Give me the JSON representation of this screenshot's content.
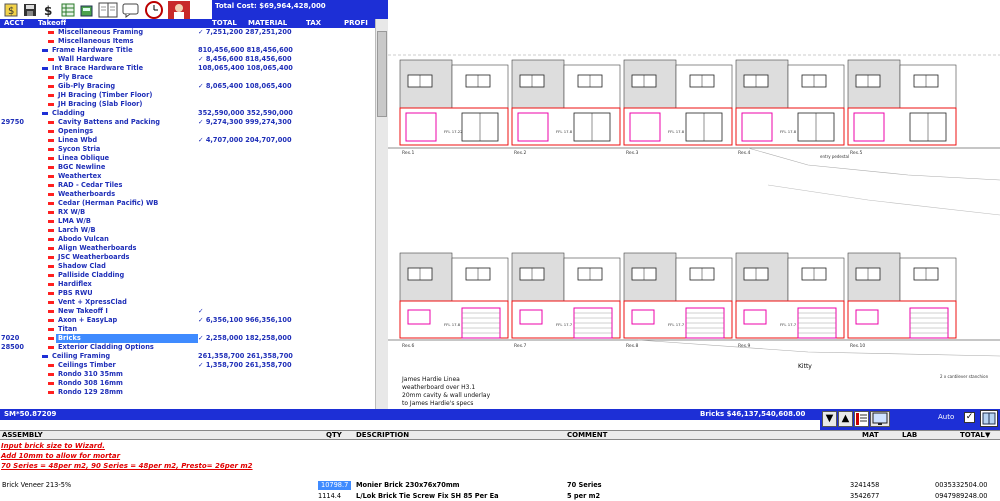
{
  "toolbar": {
    "icons": [
      "dollar-icon",
      "save-icon",
      "money-icon",
      "spreadsheet-icon",
      "calculator-icon",
      "open-book-icon",
      "clock-icon",
      "user-avatar-icon"
    ],
    "total_cost": "Total Cost: $69,964,428,000"
  },
  "takeoff_header": {
    "acct": "ACCT",
    "takeoff": "Takeoff",
    "total": "TOTAL",
    "material": "MATERIAL",
    "tax": "TAX",
    "profit": "PROFI"
  },
  "tree": {
    "rows": [
      {
        "acct": "",
        "level": 3,
        "color": "#ff2020",
        "label": "Miscellaneous Framing",
        "total": "✓ 7,251,200 287,251,200"
      },
      {
        "acct": "",
        "level": 3,
        "color": "#ff2020",
        "label": "Miscellaneous Items",
        "total": ""
      },
      {
        "acct": "",
        "level": 2,
        "color": "#1d2fd6",
        "label": "Frame Hardware Title",
        "total": "810,456,600 818,456,600"
      },
      {
        "acct": "",
        "level": 3,
        "color": "#ff2020",
        "label": "Wall Hardware",
        "total": "✓ 8,456,600 818,456,600"
      },
      {
        "acct": "",
        "level": 2,
        "color": "#1d2fd6",
        "label": "Int Brace Hardware Title",
        "total": "108,065,400 108,065,400"
      },
      {
        "acct": "",
        "level": 3,
        "color": "#ff2020",
        "label": "Ply Brace",
        "total": ""
      },
      {
        "acct": "",
        "level": 3,
        "color": "#ff2020",
        "label": "Gib-Ply Bracing",
        "total": "✓ 8,065,400 108,065,400"
      },
      {
        "acct": "",
        "level": 3,
        "color": "#ff2020",
        "label": "JH Bracing (Timber Floor)",
        "total": ""
      },
      {
        "acct": "",
        "level": 3,
        "color": "#ff2020",
        "label": "JH Bracing (Slab Floor)",
        "total": ""
      },
      {
        "acct": "",
        "level": 2,
        "color": "#1d2fd6",
        "label": "Cladding",
        "total": "352,590,000 352,590,000"
      },
      {
        "acct": "29750",
        "level": 3,
        "color": "#ff2020",
        "label": "Cavity Battens and Packing",
        "total": "✓ 9,274,300 999,274,300"
      },
      {
        "acct": "",
        "level": 3,
        "color": "#ff2020",
        "label": "Openings",
        "total": ""
      },
      {
        "acct": "",
        "level": 3,
        "color": "#ff2020",
        "label": "Linea Wbd",
        "total": "✓ 4,707,000 204,707,000"
      },
      {
        "acct": "",
        "level": 3,
        "color": "#ff2020",
        "label": "Sycon Stria",
        "total": ""
      },
      {
        "acct": "",
        "level": 3,
        "color": "#ff2020",
        "label": "Linea Oblique",
        "total": ""
      },
      {
        "acct": "",
        "level": 3,
        "color": "#ff2020",
        "label": "BGC Newline",
        "total": ""
      },
      {
        "acct": "",
        "level": 3,
        "color": "#ff2020",
        "label": "Weathertex",
        "total": ""
      },
      {
        "acct": "",
        "level": 3,
        "color": "#ff2020",
        "label": "RAD - Cedar Tiles",
        "total": ""
      },
      {
        "acct": "",
        "level": 3,
        "color": "#ff2020",
        "label": "Weatherboards",
        "total": ""
      },
      {
        "acct": "",
        "level": 3,
        "color": "#ff2020",
        "label": "Cedar (Herman Pacific) WB",
        "total": ""
      },
      {
        "acct": "",
        "level": 3,
        "color": "#ff2020",
        "label": "RX W/B",
        "total": ""
      },
      {
        "acct": "",
        "level": 3,
        "color": "#ff2020",
        "label": "LMA W/B",
        "total": ""
      },
      {
        "acct": "",
        "level": 3,
        "color": "#ff2020",
        "label": "Larch W/B",
        "total": ""
      },
      {
        "acct": "",
        "level": 3,
        "color": "#ff2020",
        "label": "Abodo Vulcan",
        "total": ""
      },
      {
        "acct": "",
        "level": 3,
        "color": "#ff2020",
        "label": "Align Weatherboards",
        "total": ""
      },
      {
        "acct": "",
        "level": 3,
        "color": "#ff2020",
        "label": "JSC Weatherboards",
        "total": ""
      },
      {
        "acct": "",
        "level": 3,
        "color": "#ff2020",
        "label": "Shadow Clad",
        "total": ""
      },
      {
        "acct": "",
        "level": 3,
        "color": "#ff2020",
        "label": "Palliside Cladding",
        "total": ""
      },
      {
        "acct": "",
        "level": 3,
        "color": "#ff2020",
        "label": "Hardiflex",
        "total": ""
      },
      {
        "acct": "",
        "level": 3,
        "color": "#ff2020",
        "label": "PBS RWU",
        "total": ""
      },
      {
        "acct": "",
        "level": 3,
        "color": "#ff2020",
        "label": "Vent + XpressClad",
        "total": ""
      },
      {
        "acct": "",
        "level": 3,
        "color": "#ff2020",
        "label": "New Takeoff I",
        "total": "✓"
      },
      {
        "acct": "",
        "level": 3,
        "color": "#ff2020",
        "label": "Axon + EasyLap",
        "total": "✓ 6,356,100 966,356,100"
      },
      {
        "acct": "",
        "level": 3,
        "color": "#ff2020",
        "label": "Titan",
        "total": ""
      },
      {
        "acct": "7020",
        "level": 3,
        "color": "#ff2020",
        "label": "Bricks",
        "total": "✓ 2,258,000 182,258,000",
        "selected": true
      },
      {
        "acct": "28500",
        "level": 3,
        "color": "#ff2020",
        "label": "Exterior Cladding Options",
        "total": ""
      },
      {
        "acct": "",
        "level": 2,
        "color": "#1d2fd6",
        "label": "Ceiling Framing",
        "total": "261,358,700 261,358,700"
      },
      {
        "acct": "",
        "level": 3,
        "color": "#ff2020",
        "label": "Ceilings Timber",
        "total": "✓ 1,358,700 261,358,700"
      },
      {
        "acct": "",
        "level": 3,
        "color": "#ff2020",
        "label": "Rondo 310 35mm",
        "total": ""
      },
      {
        "acct": "",
        "level": 3,
        "color": "#ff2020",
        "label": "Rondo 308 16mm",
        "total": ""
      },
      {
        "acct": "",
        "level": 3,
        "color": "#ff2020",
        "label": "Rondo 129 28mm",
        "total": ""
      }
    ]
  },
  "drawing": {
    "upper_labels": [
      "Res.1",
      "Res.2",
      "Res.3",
      "Res.4",
      "Res.5"
    ],
    "lower_labels": [
      "Res.6",
      "Res.7",
      "Res.8",
      "Res.9",
      "Res.10"
    ],
    "upper_ffl": [
      "FFL 17.22",
      "FFL 17.8",
      "FFL 17.8",
      "FFL 17.8"
    ],
    "lower_ffl": [
      "FFL 17.8",
      "FFL 17.7",
      "FFL 17.7",
      "FFL 17.7"
    ],
    "upper_note": "entry pedestal",
    "side_note": "2 x cantilever stanchion",
    "note_title": "Kitty",
    "note_lines": [
      "James Hardie Linea",
      "weatherboard over H3.1",
      "20mm cavity & wall underlay",
      "to James Hardie's specs"
    ]
  },
  "status_bar": {
    "left": "SM*50.87209",
    "right": "Bricks $46,137,540,608.00",
    "auto_label": "Auto",
    "icons": [
      "down-arrow-icon",
      "up-arrow-icon",
      "grid-view-icon",
      "monitor-icon",
      "book-icon"
    ]
  },
  "assembly_header": {
    "assembly": "ASSEMBLY",
    "qty": "QTY",
    "description": "DESCRIPTION",
    "comment": "COMMENT",
    "mat": "MAT",
    "lab": "LAB",
    "total": "TOTAL"
  },
  "notes": [
    "Input brick size to Wizard.",
    "Add 10mm to allow for mortar",
    "70 Series = 48per m2, 90 Series = 48per m2, Presto= 26per m2"
  ],
  "assembly_rows": [
    {
      "assembly": "Brick Veneer  213-5%",
      "qty": "10798.7",
      "description": "Monier Brick 230x76x70mm",
      "comment": "70 Series",
      "mat": "3241458",
      "total": "0035332504.00",
      "selected": true
    },
    {
      "assembly": "",
      "qty": "1114.4",
      "description": "L/Lok Brick Tie Screw Fix SH 85  Per Ea",
      "comment": "5 per m2",
      "mat": "3542677",
      "total": "0947989248.00"
    }
  ]
}
